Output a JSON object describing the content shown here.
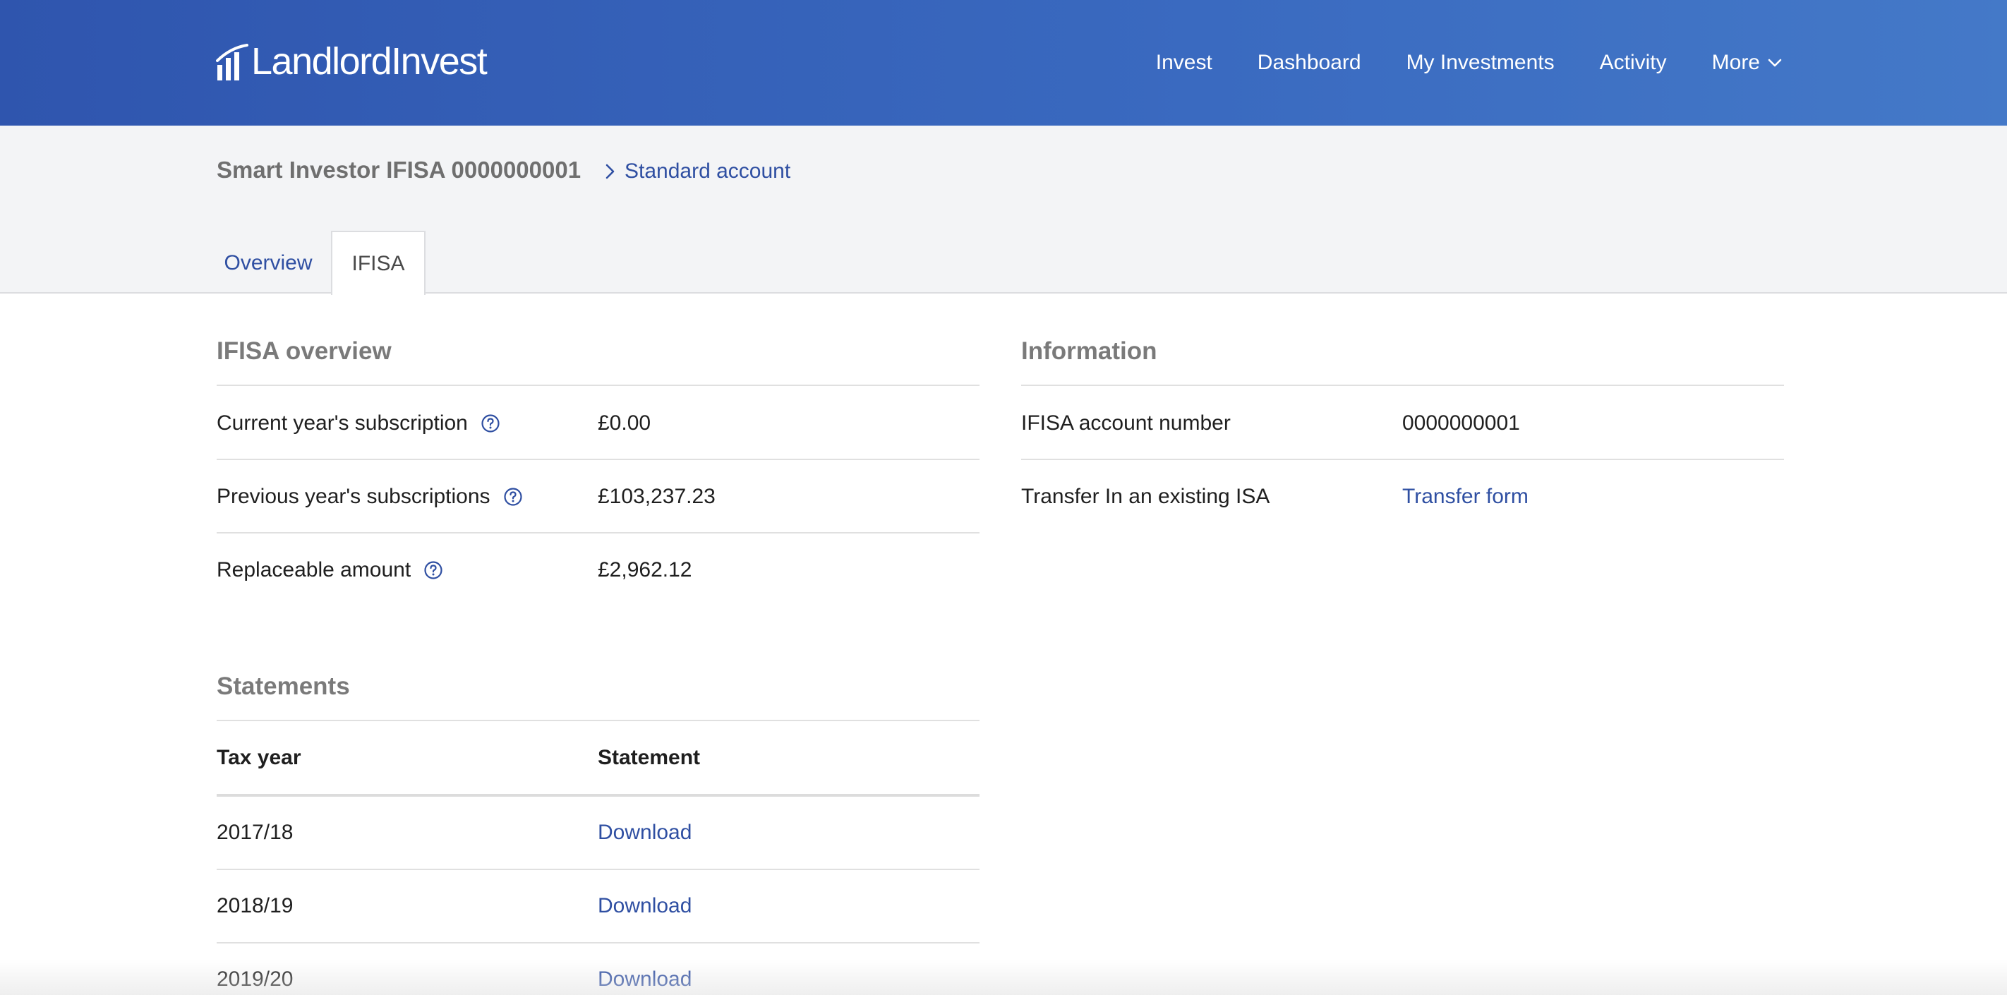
{
  "header": {
    "logo_text": "LandlordInvest",
    "nav": [
      {
        "label": "Invest"
      },
      {
        "label": "Dashboard"
      },
      {
        "label": "My Investments"
      },
      {
        "label": "Activity"
      },
      {
        "label": "More"
      }
    ]
  },
  "account": {
    "title": "Smart Investor IFISA 0000000001",
    "switch_link": "Standard account"
  },
  "tabs": [
    {
      "label": "Overview",
      "active": false
    },
    {
      "label": "IFISA",
      "active": true
    }
  ],
  "ifisa_overview": {
    "title": "IFISA overview",
    "rows": [
      {
        "label": "Current year's subscription",
        "value": "£0.00"
      },
      {
        "label": "Previous year's subscriptions",
        "value": "£103,237.23"
      },
      {
        "label": "Replaceable amount",
        "value": "£2,962.12"
      }
    ]
  },
  "information": {
    "title": "Information",
    "rows": [
      {
        "label": "IFISA account number",
        "value": "0000000001"
      },
      {
        "label": "Transfer In an existing ISA",
        "value": "Transfer form"
      }
    ]
  },
  "statements": {
    "title": "Statements",
    "columns": [
      "Tax year",
      "Statement"
    ],
    "rows": [
      {
        "year": "2017/18",
        "action": "Download"
      },
      {
        "year": "2018/19",
        "action": "Download"
      },
      {
        "year": "2019/20",
        "action": "Download"
      }
    ]
  },
  "colors": {
    "header_start": "#2f55ae",
    "header_end": "#4479c8",
    "link": "#2f4fa2",
    "section_title": "#7a7a7a"
  }
}
